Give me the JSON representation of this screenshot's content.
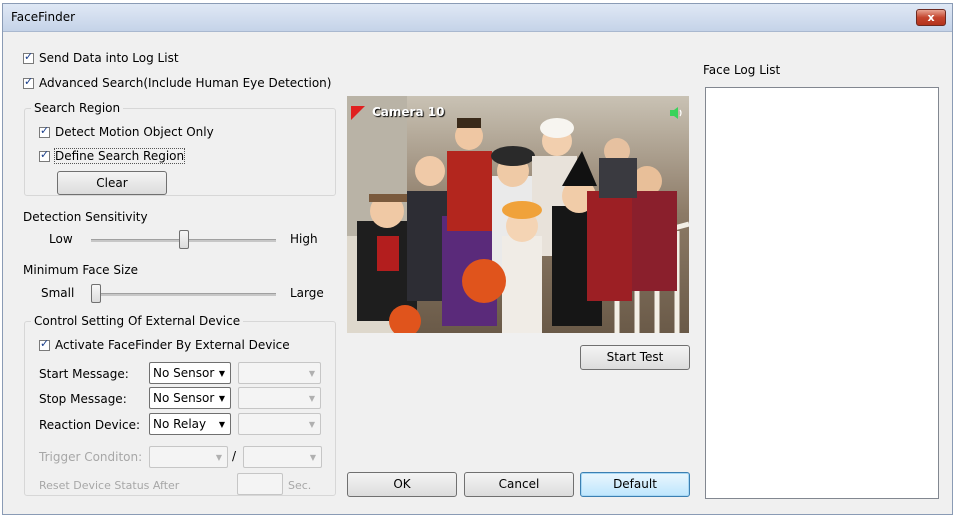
{
  "window": {
    "title": "FaceFinder",
    "close_label": "x"
  },
  "options": {
    "send_data": "Send Data into Log List",
    "advanced_search": "Advanced Search(Include Human Eye Detection)"
  },
  "search_region": {
    "title": "Search Region",
    "detect_motion": "Detect Motion Object Only",
    "define_region": "Define Search Region",
    "clear_label": "Clear"
  },
  "sensitivity": {
    "title": "Detection Sensitivity",
    "low": "Low",
    "high": "High",
    "level": 0.5
  },
  "face_size": {
    "title": "Minimum Face Size",
    "small": "Small",
    "large": "Large",
    "level": 0.0
  },
  "external": {
    "title": "Control Setting Of External Device",
    "activate": "Activate FaceFinder By External Device",
    "start_message": "Start Message:",
    "stop_message": "Stop Message:",
    "reaction_device": "Reaction Device:",
    "start_value": "No Sensor",
    "stop_value": "No Sensor",
    "reaction_value": "No Relay",
    "trigger_label": "Trigger Conditon:",
    "trigger_sep": "/",
    "reset_label": "Reset Device Status After",
    "sec_label": "Sec."
  },
  "camera": {
    "label": "Camera 10"
  },
  "buttons": {
    "start_test": "Start Test",
    "ok": "OK",
    "cancel": "Cancel",
    "default": "Default"
  },
  "log": {
    "title": "Face Log List"
  },
  "colors": {
    "titlebar": "#c5d3e8",
    "close": "#c4452e",
    "camera_marker": "#e02020",
    "speaker": "#39d35a"
  }
}
